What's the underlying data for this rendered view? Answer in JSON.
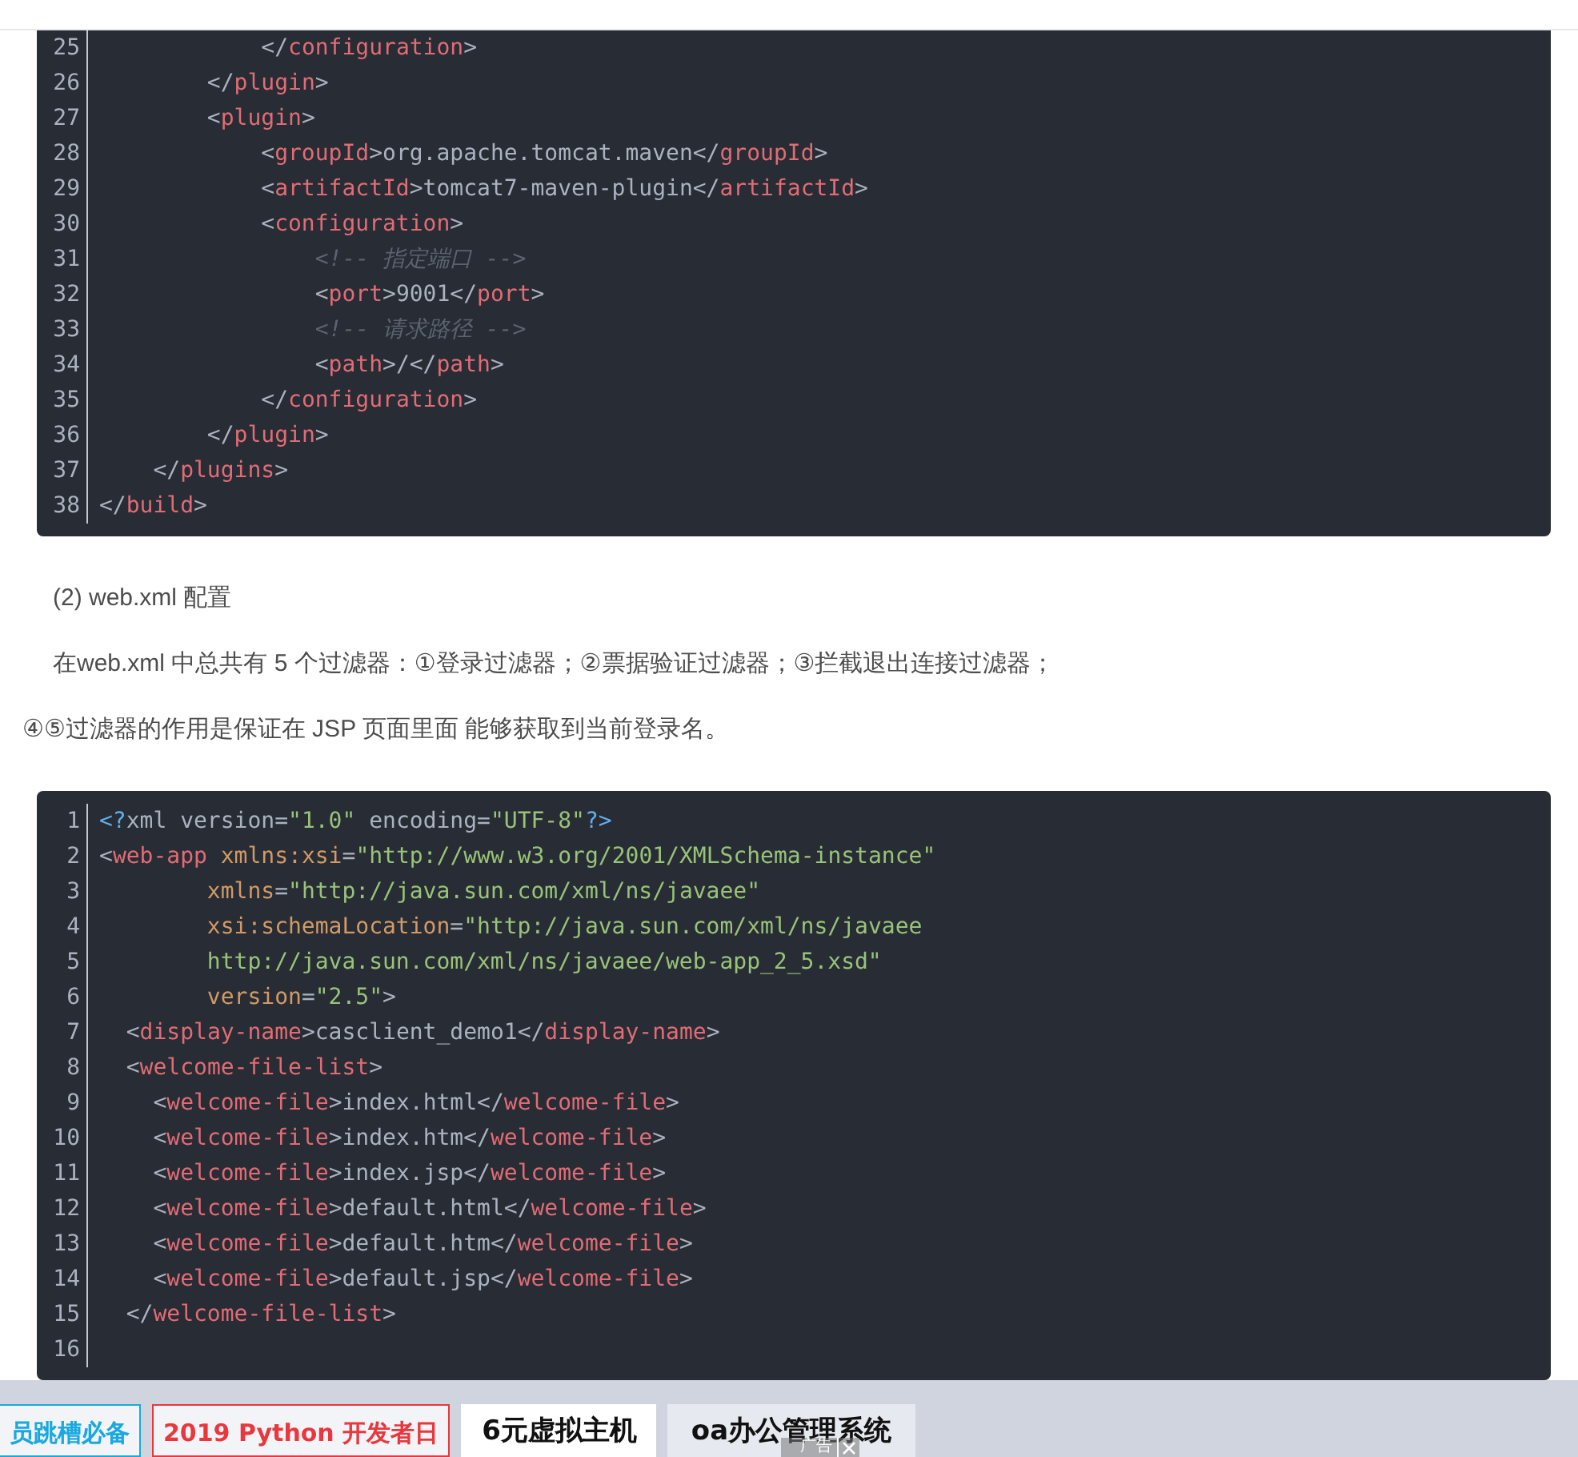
{
  "code_blocks": [
    {
      "lines": [
        {
          "number": "25",
          "tokens": [
            {
              "kind": "plain",
              "text": "            </"
            },
            {
              "kind": "tag",
              "text": "configuration"
            },
            {
              "kind": "plain",
              "text": ">"
            }
          ]
        },
        {
          "number": "26",
          "tokens": [
            {
              "kind": "plain",
              "text": "        </"
            },
            {
              "kind": "tag",
              "text": "plugin"
            },
            {
              "kind": "plain",
              "text": ">"
            }
          ]
        },
        {
          "number": "27",
          "tokens": [
            {
              "kind": "plain",
              "text": "        <"
            },
            {
              "kind": "tag",
              "text": "plugin"
            },
            {
              "kind": "plain",
              "text": ">"
            }
          ]
        },
        {
          "number": "28",
          "tokens": [
            {
              "kind": "plain",
              "text": "            <"
            },
            {
              "kind": "tag",
              "text": "groupId"
            },
            {
              "kind": "plain",
              "text": ">org.apache.tomcat.maven</"
            },
            {
              "kind": "tag",
              "text": "groupId"
            },
            {
              "kind": "plain",
              "text": ">"
            }
          ]
        },
        {
          "number": "29",
          "tokens": [
            {
              "kind": "plain",
              "text": "            <"
            },
            {
              "kind": "tag",
              "text": "artifactId"
            },
            {
              "kind": "plain",
              "text": ">tomcat7-maven-plugin</"
            },
            {
              "kind": "tag",
              "text": "artifactId"
            },
            {
              "kind": "plain",
              "text": ">"
            }
          ]
        },
        {
          "number": "30",
          "tokens": [
            {
              "kind": "plain",
              "text": "            <"
            },
            {
              "kind": "tag",
              "text": "configuration"
            },
            {
              "kind": "plain",
              "text": ">"
            }
          ]
        },
        {
          "number": "31",
          "tokens": [
            {
              "kind": "comment",
              "text": "                <!-- 指定端口 -->"
            }
          ]
        },
        {
          "number": "32",
          "tokens": [
            {
              "kind": "plain",
              "text": "                <"
            },
            {
              "kind": "tag",
              "text": "port"
            },
            {
              "kind": "plain",
              "text": ">9001</"
            },
            {
              "kind": "tag",
              "text": "port"
            },
            {
              "kind": "plain",
              "text": ">"
            }
          ]
        },
        {
          "number": "33",
          "tokens": [
            {
              "kind": "comment",
              "text": "                <!-- 请求路径 -->"
            }
          ]
        },
        {
          "number": "34",
          "tokens": [
            {
              "kind": "plain",
              "text": "                <"
            },
            {
              "kind": "tag",
              "text": "path"
            },
            {
              "kind": "plain",
              "text": ">/</"
            },
            {
              "kind": "tag",
              "text": "path"
            },
            {
              "kind": "plain",
              "text": ">"
            }
          ]
        },
        {
          "number": "35",
          "tokens": [
            {
              "kind": "plain",
              "text": "            </"
            },
            {
              "kind": "tag",
              "text": "configuration"
            },
            {
              "kind": "plain",
              "text": ">"
            }
          ]
        },
        {
          "number": "36",
          "tokens": [
            {
              "kind": "plain",
              "text": "        </"
            },
            {
              "kind": "tag",
              "text": "plugin"
            },
            {
              "kind": "plain",
              "text": ">"
            }
          ]
        },
        {
          "number": "37",
          "tokens": [
            {
              "kind": "plain",
              "text": "    </"
            },
            {
              "kind": "tag",
              "text": "plugins"
            },
            {
              "kind": "plain",
              "text": ">"
            }
          ]
        },
        {
          "number": "38",
          "tokens": [
            {
              "kind": "plain",
              "text": "</"
            },
            {
              "kind": "tag",
              "text": "build"
            },
            {
              "kind": "plain",
              "text": ">"
            }
          ]
        }
      ]
    },
    {
      "lines": [
        {
          "number": "1",
          "tokens": [
            {
              "kind": "meta",
              "text": "<?"
            },
            {
              "kind": "plain",
              "text": "xml version="
            },
            {
              "kind": "string",
              "text": "\"1.0\""
            },
            {
              "kind": "plain",
              "text": " encoding="
            },
            {
              "kind": "string",
              "text": "\"UTF-8\""
            },
            {
              "kind": "meta",
              "text": "?>"
            }
          ]
        },
        {
          "number": "2",
          "tokens": [
            {
              "kind": "plain",
              "text": "<"
            },
            {
              "kind": "tag",
              "text": "web-app"
            },
            {
              "kind": "attr",
              "text": " xmlns:xsi"
            },
            {
              "kind": "plain",
              "text": "="
            },
            {
              "kind": "string",
              "text": "\"http://www.w3.org/2001/XMLSchema-instance\""
            }
          ]
        },
        {
          "number": "3",
          "tokens": [
            {
              "kind": "attr",
              "text": "        xmlns"
            },
            {
              "kind": "plain",
              "text": "="
            },
            {
              "kind": "string",
              "text": "\"http://java.sun.com/xml/ns/javaee\""
            }
          ]
        },
        {
          "number": "4",
          "tokens": [
            {
              "kind": "attr",
              "text": "        xsi:schemaLocation"
            },
            {
              "kind": "plain",
              "text": "="
            },
            {
              "kind": "string",
              "text": "\"http://java.sun.com/xml/ns/javaee"
            }
          ]
        },
        {
          "number": "5",
          "tokens": [
            {
              "kind": "string",
              "text": "        http://java.sun.com/xml/ns/javaee/web-app_2_5.xsd\""
            }
          ]
        },
        {
          "number": "6",
          "tokens": [
            {
              "kind": "attr",
              "text": "        version"
            },
            {
              "kind": "plain",
              "text": "="
            },
            {
              "kind": "string",
              "text": "\"2.5\""
            },
            {
              "kind": "plain",
              "text": ">"
            }
          ]
        },
        {
          "number": "7",
          "tokens": [
            {
              "kind": "plain",
              "text": "  <"
            },
            {
              "kind": "tag",
              "text": "display-name"
            },
            {
              "kind": "plain",
              "text": ">casclient_demo1</"
            },
            {
              "kind": "tag",
              "text": "display-name"
            },
            {
              "kind": "plain",
              "text": ">"
            }
          ]
        },
        {
          "number": "8",
          "tokens": [
            {
              "kind": "plain",
              "text": "  <"
            },
            {
              "kind": "tag",
              "text": "welcome-file-list"
            },
            {
              "kind": "plain",
              "text": ">"
            }
          ]
        },
        {
          "number": "9",
          "tokens": [
            {
              "kind": "plain",
              "text": "    <"
            },
            {
              "kind": "tag",
              "text": "welcome-file"
            },
            {
              "kind": "plain",
              "text": ">index.html</"
            },
            {
              "kind": "tag",
              "text": "welcome-file"
            },
            {
              "kind": "plain",
              "text": ">"
            }
          ]
        },
        {
          "number": "10",
          "tokens": [
            {
              "kind": "plain",
              "text": "    <"
            },
            {
              "kind": "tag",
              "text": "welcome-file"
            },
            {
              "kind": "plain",
              "text": ">index.htm</"
            },
            {
              "kind": "tag",
              "text": "welcome-file"
            },
            {
              "kind": "plain",
              "text": ">"
            }
          ]
        },
        {
          "number": "11",
          "tokens": [
            {
              "kind": "plain",
              "text": "    <"
            },
            {
              "kind": "tag",
              "text": "welcome-file"
            },
            {
              "kind": "plain",
              "text": ">index.jsp</"
            },
            {
              "kind": "tag",
              "text": "welcome-file"
            },
            {
              "kind": "plain",
              "text": ">"
            }
          ]
        },
        {
          "number": "12",
          "tokens": [
            {
              "kind": "plain",
              "text": "    <"
            },
            {
              "kind": "tag",
              "text": "welcome-file"
            },
            {
              "kind": "plain",
              "text": ">default.html</"
            },
            {
              "kind": "tag",
              "text": "welcome-file"
            },
            {
              "kind": "plain",
              "text": ">"
            }
          ]
        },
        {
          "number": "13",
          "tokens": [
            {
              "kind": "plain",
              "text": "    <"
            },
            {
              "kind": "tag",
              "text": "welcome-file"
            },
            {
              "kind": "plain",
              "text": ">default.htm</"
            },
            {
              "kind": "tag",
              "text": "welcome-file"
            },
            {
              "kind": "plain",
              "text": ">"
            }
          ]
        },
        {
          "number": "14",
          "tokens": [
            {
              "kind": "plain",
              "text": "    <"
            },
            {
              "kind": "tag",
              "text": "welcome-file"
            },
            {
              "kind": "plain",
              "text": ">default.jsp</"
            },
            {
              "kind": "tag",
              "text": "welcome-file"
            },
            {
              "kind": "plain",
              "text": ">"
            }
          ]
        },
        {
          "number": "15",
          "tokens": [
            {
              "kind": "plain",
              "text": "  </"
            },
            {
              "kind": "tag",
              "text": "welcome-file-list"
            },
            {
              "kind": "plain",
              "text": ">"
            }
          ]
        },
        {
          "number": "16"
        }
      ]
    }
  ],
  "paragraphs": [
    {
      "kind": "indented",
      "text": "(2) web.xml 配置"
    },
    {
      "kind": "indented",
      "text": "在web.xml 中总共有 5 个过滤器：①登录过滤器；②票据验证过滤器；③拦截退出连接过滤器；"
    },
    {
      "kind": "flush",
      "text": "④⑤过滤器的作用是保证在 JSP 页面里面 能够获取到当前登录名。"
    }
  ],
  "ad_bar": {
    "items": [
      {
        "kind": "outlined",
        "color": "#1aa8e0",
        "label": "员跳槽必备"
      },
      {
        "kind": "outlined",
        "color": "#e8383d",
        "label": "2019 Python 开发者日"
      },
      {
        "kind": "white",
        "color": "#111111",
        "label": "6元虚拟主机"
      },
      {
        "kind": "shaded",
        "color": "#111111",
        "label": "oa办公管理系统"
      }
    ],
    "ad_label": "广告"
  }
}
